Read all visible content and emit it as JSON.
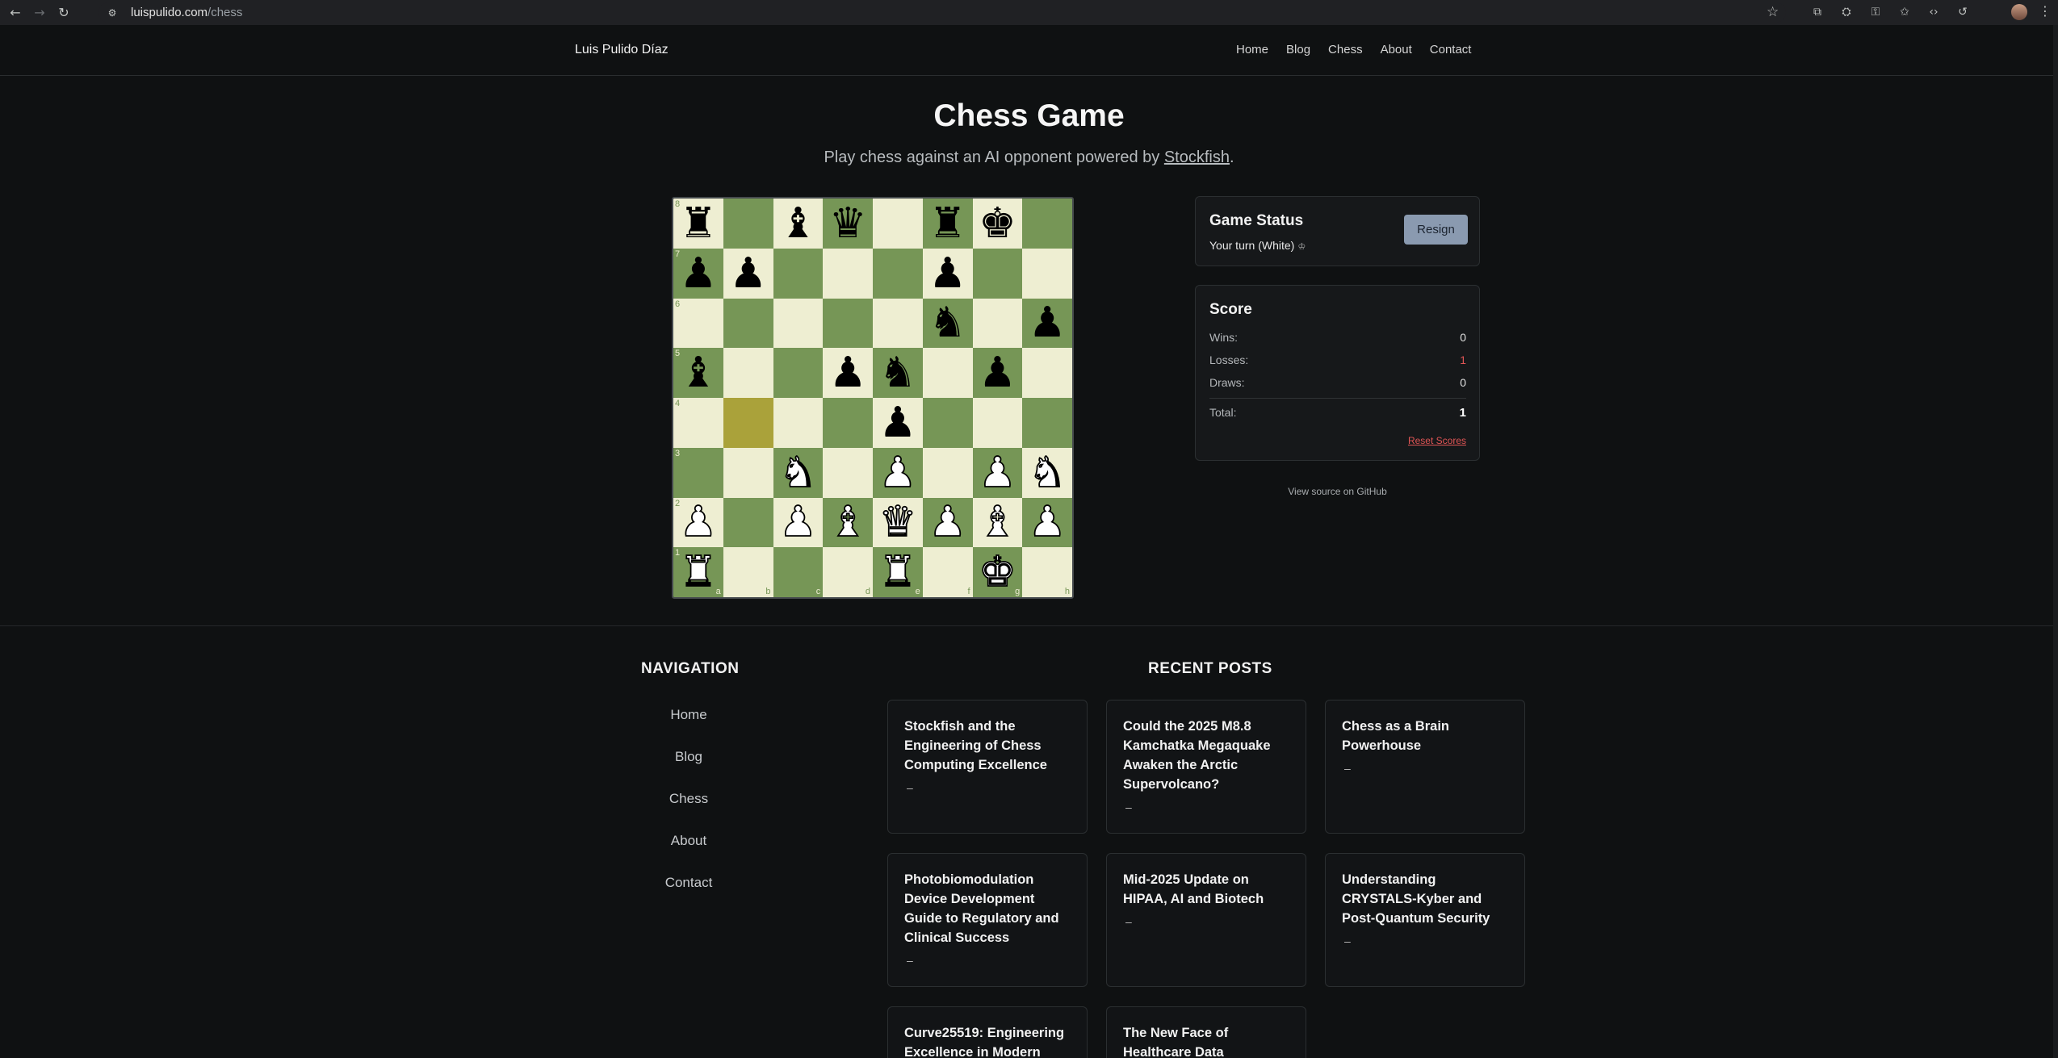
{
  "browser": {
    "url_host": "luispulido.com",
    "url_path": "/chess"
  },
  "site": {
    "title": "Luis Pulido Díaz",
    "nav": [
      "Home",
      "Blog",
      "Chess",
      "About",
      "Contact"
    ]
  },
  "page": {
    "title": "Chess Game",
    "subtitle_pre": "Play chess against an AI opponent powered by ",
    "subtitle_link": "Stockfish",
    "subtitle_post": "."
  },
  "board": {
    "rank_labels": [
      "8",
      "7",
      "6",
      "5",
      "4",
      "3",
      "2",
      "1"
    ],
    "file_labels": [
      "a",
      "b",
      "c",
      "d",
      "e",
      "f",
      "g",
      "h"
    ],
    "highlight_squares": [
      "b4"
    ],
    "position": [
      [
        "bR",
        "",
        "bB",
        "bQ",
        "",
        "bR",
        "bK",
        ""
      ],
      [
        "bP",
        "bP",
        "",
        "",
        "",
        "bP",
        "",
        ""
      ],
      [
        "",
        "",
        "",
        "",
        "",
        "bN",
        "",
        "bP"
      ],
      [
        "bB",
        "",
        "",
        "bP",
        "bN",
        "",
        "bP",
        ""
      ],
      [
        "",
        "",
        "",
        "",
        "bP",
        "",
        "",
        ""
      ],
      [
        "",
        "",
        "wN",
        "",
        "wP",
        "",
        "wP",
        "wN"
      ],
      [
        "wP",
        "",
        "wP",
        "wB",
        "wQ",
        "wP",
        "wB",
        "wP"
      ],
      [
        "wR",
        "",
        "",
        "",
        "wR",
        "",
        "wK",
        ""
      ]
    ]
  },
  "status": {
    "title": "Game Status",
    "text": "Your turn (White)",
    "glyph": "♔",
    "resign_label": "Resign"
  },
  "score": {
    "title": "Score",
    "wins_label": "Wins:",
    "wins": "0",
    "losses_label": "Losses:",
    "losses": "1",
    "draws_label": "Draws:",
    "draws": "0",
    "total_label": "Total:",
    "total": "1",
    "reset_label": "Reset Scores"
  },
  "github_link": "View source on GitHub",
  "footer": {
    "nav_heading": "NAVIGATION",
    "nav": [
      "Home",
      "Blog",
      "Chess",
      "About",
      "Contact"
    ],
    "posts_heading": "RECENT POSTS",
    "posts": [
      {
        "title": "Stockfish and the Engineering of Chess Computing Excellence",
        "meta": "–"
      },
      {
        "title": "Could the 2025 M8.8 Kamchatka Megaquake Awaken the Arctic Supervolcano?",
        "meta": "–"
      },
      {
        "title": "Chess as a Brain Powerhouse",
        "meta": "–"
      },
      {
        "title": "Photobiomodulation Device Development Guide to Regulatory and Clinical Success",
        "meta": "–"
      },
      {
        "title": "Mid-2025 Update on HIPAA, AI and Biotech",
        "meta": "–"
      },
      {
        "title": "Understanding CRYSTALS-Kyber and Post-Quantum Security",
        "meta": "–"
      },
      {
        "title": "Curve25519: Engineering Excellence in Modern",
        "meta": ""
      },
      {
        "title": "The New Face of Healthcare Data",
        "meta": ""
      }
    ]
  }
}
